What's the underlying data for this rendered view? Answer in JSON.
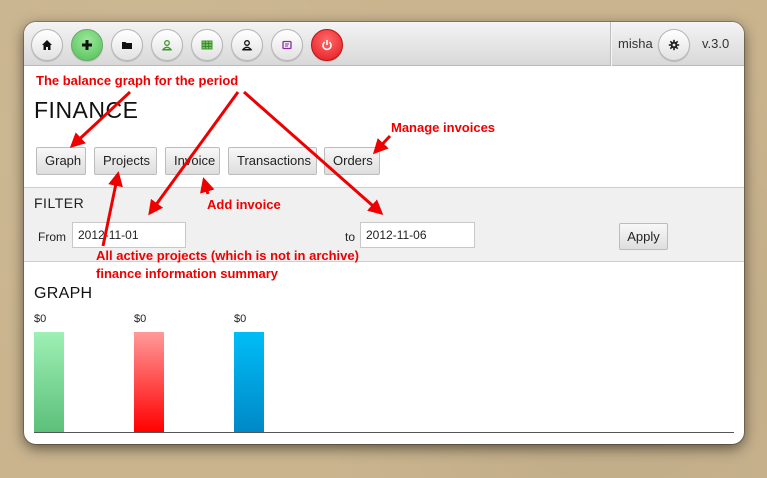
{
  "toolbar": {
    "buttons": [
      {
        "icon": "home-icon"
      },
      {
        "icon": "plus-icon",
        "color": "#4fbf55"
      },
      {
        "icon": "folder-icon"
      },
      {
        "icon": "user-green-icon",
        "color": "#3a9b2a"
      },
      {
        "icon": "spreadsheet-icon",
        "color": "#3a9b2a"
      },
      {
        "icon": "user-icon"
      },
      {
        "icon": "tag-icon",
        "color": "#8a2ba8"
      },
      {
        "icon": "power-icon",
        "color": "#e3181e"
      }
    ],
    "username": "misha",
    "settings_icon": "gear-icon",
    "version": "v.3.0"
  },
  "page": {
    "title": "FINANCE",
    "tabs": [
      "Graph",
      "Projects",
      "Invoice",
      "Transactions",
      "Orders"
    ]
  },
  "filter": {
    "title": "FILTER",
    "from_label": "From",
    "from_value": "2012-11-01",
    "to_label": "to",
    "to_value": "2012-11-06",
    "apply_label": "Apply"
  },
  "graph": {
    "title": "GRAPH",
    "bars": [
      {
        "label": "$0",
        "color": "#5cc07a"
      },
      {
        "label": "$0",
        "color": "#ff0000"
      },
      {
        "label": "$0",
        "color": "#0088c7"
      }
    ]
  },
  "annotations": {
    "balance": "The balance graph for the period",
    "manage_invoices": "Manage invoices",
    "add_invoice": "Add invoice",
    "projects_line1": "All active projects (which is not in archive)",
    "projects_line2": "finance information summary"
  },
  "colors": {
    "annotation": "#e00000",
    "toolbar_bg": "#e6e6e6",
    "filter_bg": "#f0f0f0"
  }
}
